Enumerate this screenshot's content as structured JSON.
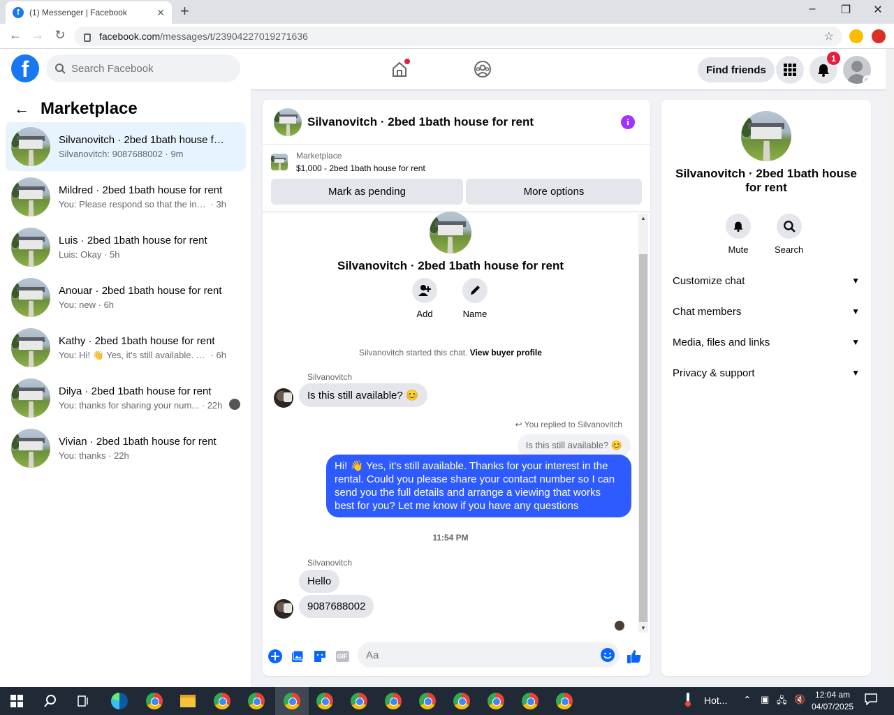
{
  "browser": {
    "tab_title": "(1) Messenger | Facebook",
    "tab_favicon": "f",
    "url_host": "facebook.com",
    "url_path": "/messages/t/23904227019271636",
    "new_tab": "+",
    "win_min": "–",
    "win_max": "❐",
    "win_close": "✕"
  },
  "header": {
    "search_placeholder": "Search Facebook",
    "find_friends": "Find friends",
    "notification_count": "1"
  },
  "sidebar": {
    "title": "Marketplace",
    "conversations": [
      {
        "name": "Silvanovitch · 2bed 1bath house for rent",
        "snippet": "Silvanovitch: 9087688002",
        "time": "9m",
        "active": true
      },
      {
        "name": "Mildred · 2bed 1bath house for rent",
        "snippet": "You: Please respond so that the infor...",
        "time": "3h"
      },
      {
        "name": "Luis · 2bed 1bath house for rent",
        "snippet": "Luis: Okay",
        "time": "5h"
      },
      {
        "name": "Anouar · 2bed 1bath house for rent",
        "snippet": "You: new",
        "time": "6h"
      },
      {
        "name": "Kathy · 2bed 1bath house for rent",
        "snippet": "You: Hi! 👋 Yes, it's still available. Tha...",
        "time": "6h"
      },
      {
        "name": "Dilya · 2bed 1bath house for rent",
        "snippet": "You: thanks for sharing your num...",
        "time": "22h"
      },
      {
        "name": "Vivian · 2bed 1bath house for rent",
        "snippet": "You: thanks",
        "time": "22h"
      }
    ]
  },
  "chat": {
    "title": "Silvanovitch · 2bed 1bath house for rent",
    "marketplace_label": "Marketplace",
    "listing": "$1,000 - 2bed 1bath house for rent",
    "mark_pending": "Mark as pending",
    "more_options": "More options",
    "intro_title": "Silvanovitch · 2bed 1bath house for rent",
    "add_label": "Add",
    "name_label": "Name",
    "started_text": "Silvanovitch started this chat.",
    "view_profile": "View buyer profile",
    "sender1": "Silvanovitch",
    "msg1": "Is this still available? 😊",
    "replied_to": "You replied to Silvanovitch",
    "quote": "Is this still available? 😊",
    "my_reply": "Hi! 👋 Yes, it's still available. Thanks for your interest in the rental. Could you please share your contact number so I can send you the full details and arrange a viewing that works best for you? Let me know if you have any questions",
    "timestamp": "11:54 PM",
    "sender2": "Silvanovitch",
    "msg2": "Hello",
    "msg3": "9087688002",
    "composer_placeholder": "Aa",
    "gif_label": "GIF"
  },
  "details": {
    "title": "Silvanovitch · 2bed 1bath house for rent",
    "mute": "Mute",
    "search": "Search",
    "sections": [
      "Customize chat",
      "Chat members",
      "Media, files and links",
      "Privacy & support"
    ]
  },
  "taskbar": {
    "weather": "Hot...",
    "time": "12:04 am",
    "date": "04/07/2025"
  },
  "colors": {
    "brand": "#1877f2",
    "my_bubble": "#2d5bff",
    "info": "#a033ff",
    "badge": "#e41e3f"
  }
}
